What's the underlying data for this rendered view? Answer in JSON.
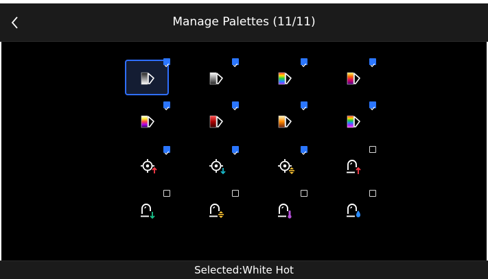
{
  "header": {
    "title": "Manage Palettes (11/11)",
    "back_icon": "chevron-left-icon"
  },
  "colors": {
    "accent": "#2b76ff",
    "background": "#000000",
    "bar": "#1b1b1b"
  },
  "palettes": [
    {
      "name": "White Hot",
      "icon": "palette-white-hot-icon",
      "checked": true,
      "selected": true
    },
    {
      "name": "Black Hot",
      "icon": "palette-black-hot-icon",
      "checked": true,
      "selected": false
    },
    {
      "name": "Rainbow",
      "icon": "palette-rainbow-icon",
      "checked": true,
      "selected": false
    },
    {
      "name": "Ironbow",
      "icon": "palette-ironbow-icon",
      "checked": true,
      "selected": false
    },
    {
      "name": "Lava",
      "icon": "palette-lava-icon",
      "checked": true,
      "selected": false
    },
    {
      "name": "Red Hot",
      "icon": "palette-red-hot-icon",
      "checked": true,
      "selected": false
    },
    {
      "name": "Sepia",
      "icon": "palette-sepia-icon",
      "checked": true,
      "selected": false
    },
    {
      "name": "Rainbow High Contrast",
      "icon": "palette-rainbow-hc-icon",
      "checked": true,
      "selected": false
    },
    {
      "name": "Target Hot",
      "icon": "target-hot-icon",
      "checked": true,
      "selected": false
    },
    {
      "name": "Target Cold",
      "icon": "target-cold-icon",
      "checked": true,
      "selected": false
    },
    {
      "name": "Target Range",
      "icon": "target-range-icon",
      "checked": true,
      "selected": false
    },
    {
      "name": "Alarm Hot",
      "icon": "alarm-hot-icon",
      "checked": false,
      "selected": false
    },
    {
      "name": "Alarm Cold",
      "icon": "alarm-cold-icon",
      "checked": false,
      "selected": false
    },
    {
      "name": "Alarm Range",
      "icon": "alarm-range-icon",
      "checked": false,
      "selected": false
    },
    {
      "name": "Alarm Isotherm",
      "icon": "alarm-isotherm-icon",
      "checked": false,
      "selected": false
    },
    {
      "name": "Alarm Humidity",
      "icon": "alarm-humidity-icon",
      "checked": false,
      "selected": false
    }
  ],
  "footer": {
    "label": "Selected:",
    "value": "White Hot"
  }
}
